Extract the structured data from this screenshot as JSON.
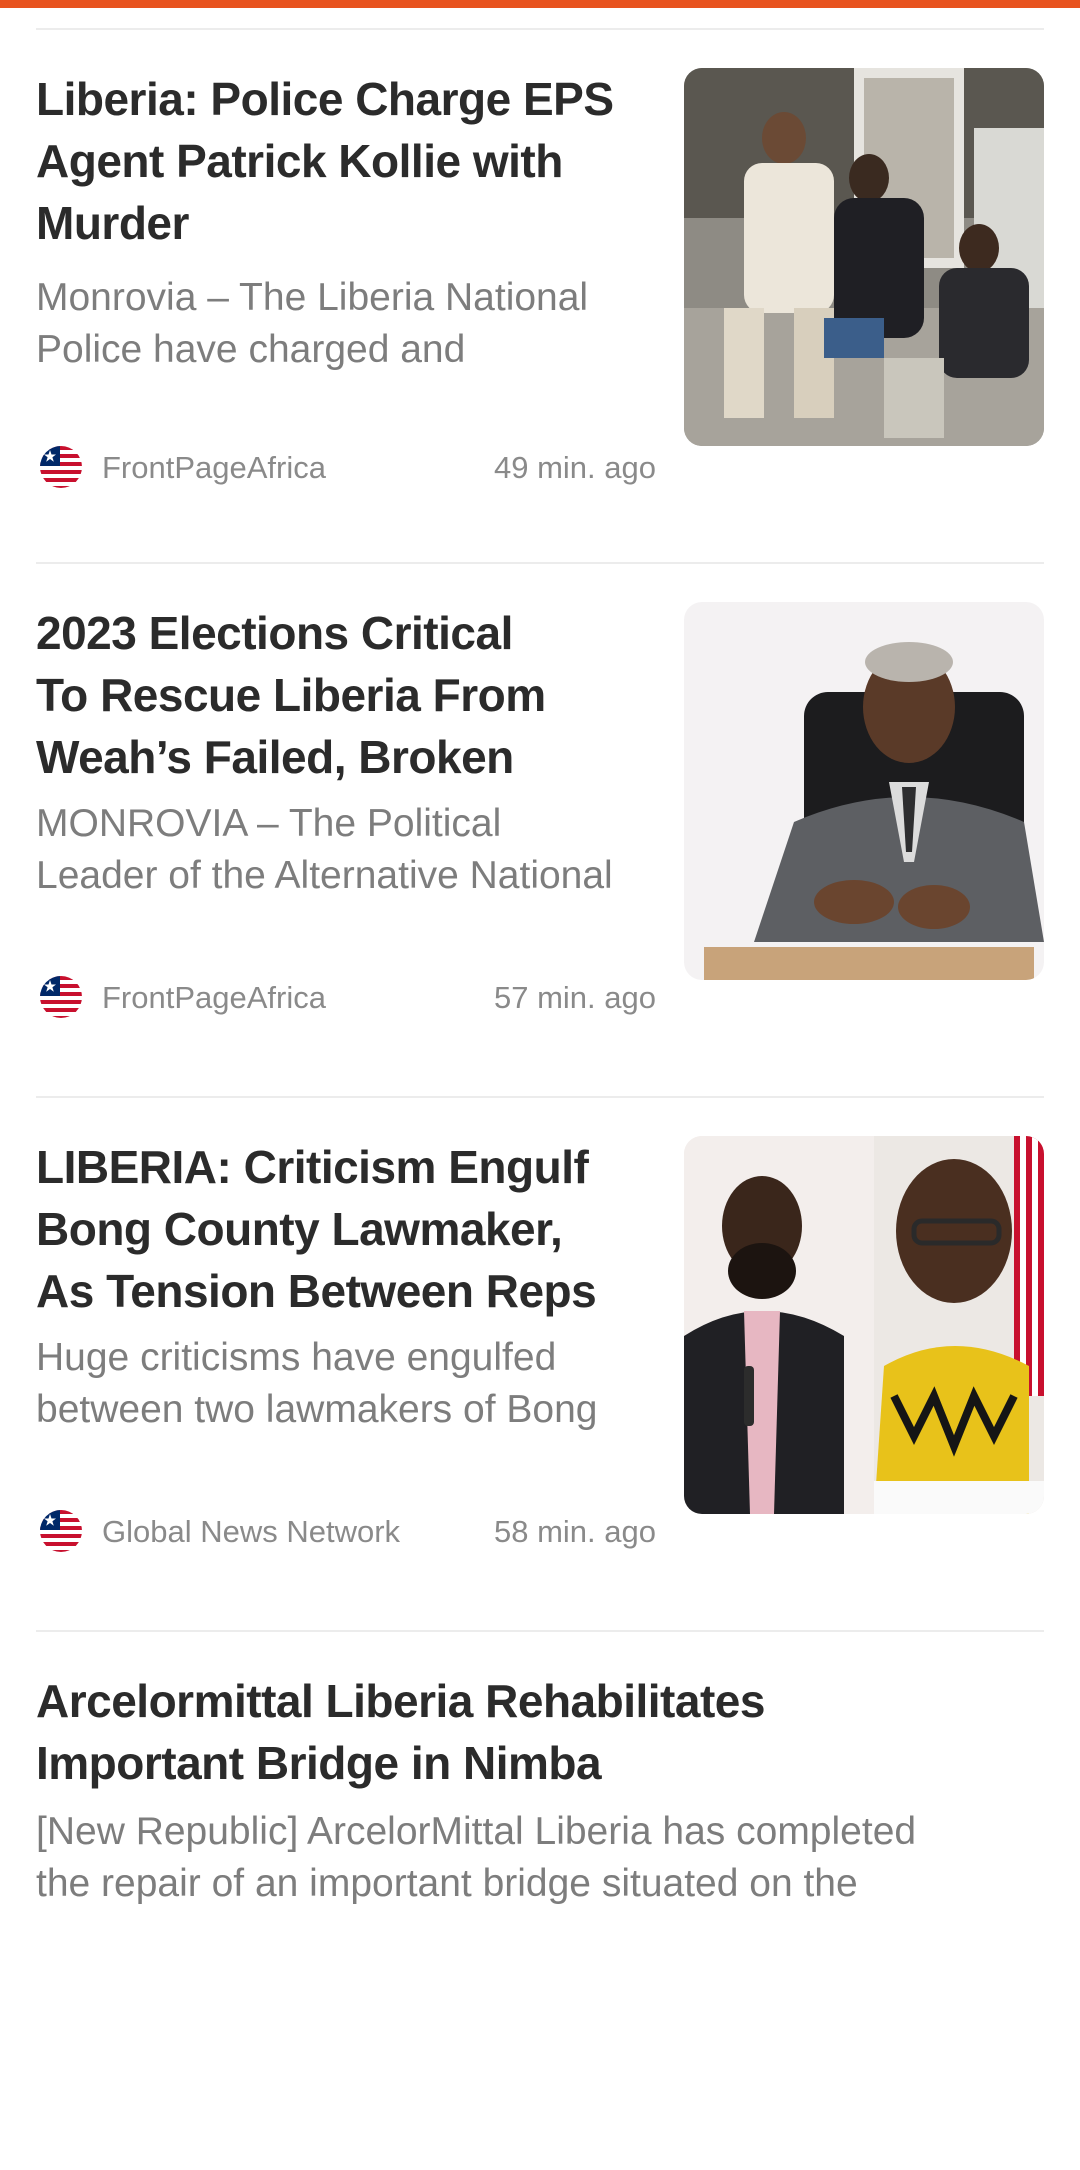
{
  "accent_color": "#e8531f",
  "articles": [
    {
      "headline_lines": [
        "Liberia: Police Charge EPS",
        "Agent Patrick Kollie with",
        "Murder"
      ],
      "snippet_lines": [
        "Monrovia – The Liberia National",
        "Police have charged and"
      ],
      "source": "FrontPageAfrica",
      "time": "49 min. ago",
      "source_icon": "liberia-flag-icon",
      "image": "photo-police-escorting-suspect"
    },
    {
      "headline_lines": [
        "2023 Elections Critical",
        "To Rescue Liberia From",
        "Weah’s Failed, Broken"
      ],
      "snippet_lines": [
        "MONROVIA – The Political",
        "Leader of the Alternative National"
      ],
      "source": "FrontPageAfrica",
      "time": "57 min. ago",
      "source_icon": "liberia-flag-icon",
      "image": "photo-politician-seated-speaking"
    },
    {
      "headline_lines": [
        "LIBERIA: Criticism Engulf",
        "Bong County Lawmaker,",
        "As Tension Between Reps"
      ],
      "snippet_lines": [
        "Huge criticisms have engulfed",
        "between two lawmakers of Bong"
      ],
      "source": "Global News Network",
      "time": "58 min. ago",
      "source_icon": "liberia-flag-icon",
      "image": "photo-two-lawmakers"
    },
    {
      "headline_lines": [
        "Arcelormittal Liberia Rehabilitates",
        "Important Bridge in Nimba"
      ],
      "snippet_lines": [
        "[New Republic] ArcelorMittal Liberia has completed",
        "the repair of an important bridge situated on the"
      ]
    }
  ]
}
